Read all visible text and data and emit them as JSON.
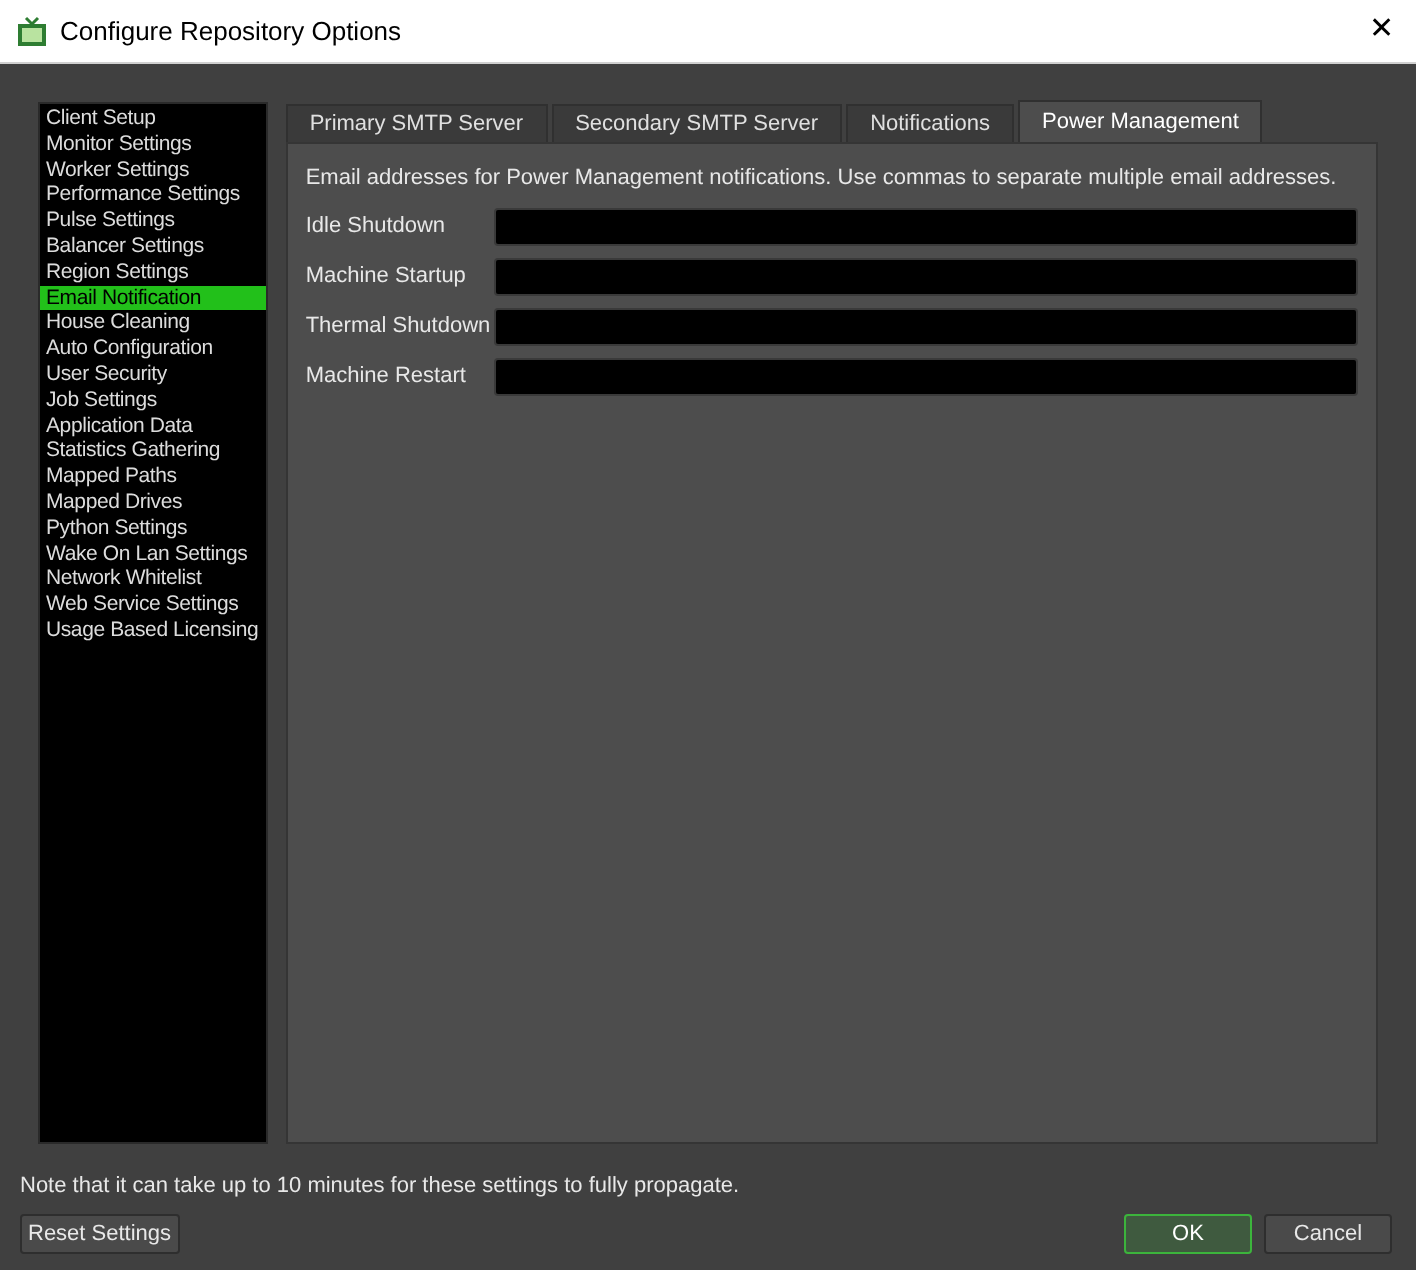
{
  "window": {
    "title": "Configure Repository Options",
    "close": "✕"
  },
  "sidebar": {
    "items": [
      {
        "label": "Client Setup",
        "selected": false
      },
      {
        "label": "Monitor Settings",
        "selected": false
      },
      {
        "label": "Worker Settings",
        "selected": false
      },
      {
        "label": "Performance Settings",
        "selected": false
      },
      {
        "label": "Pulse Settings",
        "selected": false
      },
      {
        "label": "Balancer Settings",
        "selected": false
      },
      {
        "label": "Region Settings",
        "selected": false
      },
      {
        "label": "Email Notification",
        "selected": true
      },
      {
        "label": "House Cleaning",
        "selected": false
      },
      {
        "label": "Auto Configuration",
        "selected": false
      },
      {
        "label": "User Security",
        "selected": false
      },
      {
        "label": "Job Settings",
        "selected": false
      },
      {
        "label": "Application Data",
        "selected": false
      },
      {
        "label": "Statistics Gathering",
        "selected": false
      },
      {
        "label": "Mapped Paths",
        "selected": false
      },
      {
        "label": "Mapped Drives",
        "selected": false
      },
      {
        "label": "Python Settings",
        "selected": false
      },
      {
        "label": "Wake On Lan Settings",
        "selected": false
      },
      {
        "label": "Network Whitelist",
        "selected": false
      },
      {
        "label": "Web Service Settings",
        "selected": false
      },
      {
        "label": "Usage Based Licensing",
        "selected": false
      }
    ]
  },
  "tabs": [
    {
      "label": "Primary SMTP Server",
      "selected": false
    },
    {
      "label": "Secondary SMTP Server",
      "selected": false
    },
    {
      "label": "Notifications",
      "selected": false
    },
    {
      "label": "Power Management",
      "selected": true
    }
  ],
  "panel": {
    "description": "Email addresses for Power Management notifications. Use commas to separate multiple email addresses.",
    "fields": [
      {
        "label": "Idle Shutdown"
      },
      {
        "label": "Machine Startup"
      },
      {
        "label": "Thermal Shutdown"
      },
      {
        "label": "Machine Restart"
      }
    ]
  },
  "footer": {
    "note": "Note that it can take up to 10 minutes for these settings to fully propagate.",
    "reset_button": "Reset Settings",
    "ok_button": "OK",
    "cancel_button": "Cancel"
  }
}
